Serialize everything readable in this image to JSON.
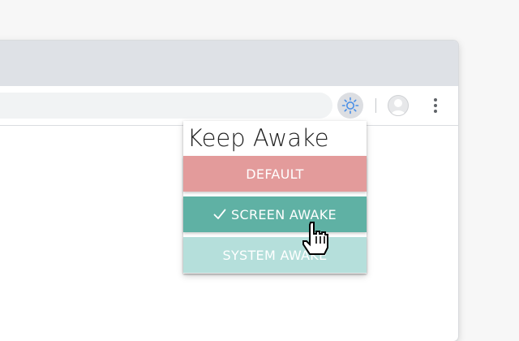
{
  "browser": {
    "toolbar": {
      "extension_icon": "sun-icon",
      "profile_icon": "avatar-icon",
      "menu_icon": "kebab-menu-icon"
    }
  },
  "popup": {
    "title": "Keep Awake",
    "options": [
      {
        "label": "DEFAULT",
        "selected": false,
        "color": "#e39b9b"
      },
      {
        "label": "SCREEN AWAKE",
        "selected": true,
        "color": "#5fb1a4"
      },
      {
        "label": "SYSTEM AWAKE",
        "selected": false,
        "color": "#b5dfdb"
      }
    ]
  },
  "colors": {
    "accent_blue": "#4a8fe7",
    "tabstrip": "#dee1e6",
    "omnibox": "#f1f3f4"
  }
}
